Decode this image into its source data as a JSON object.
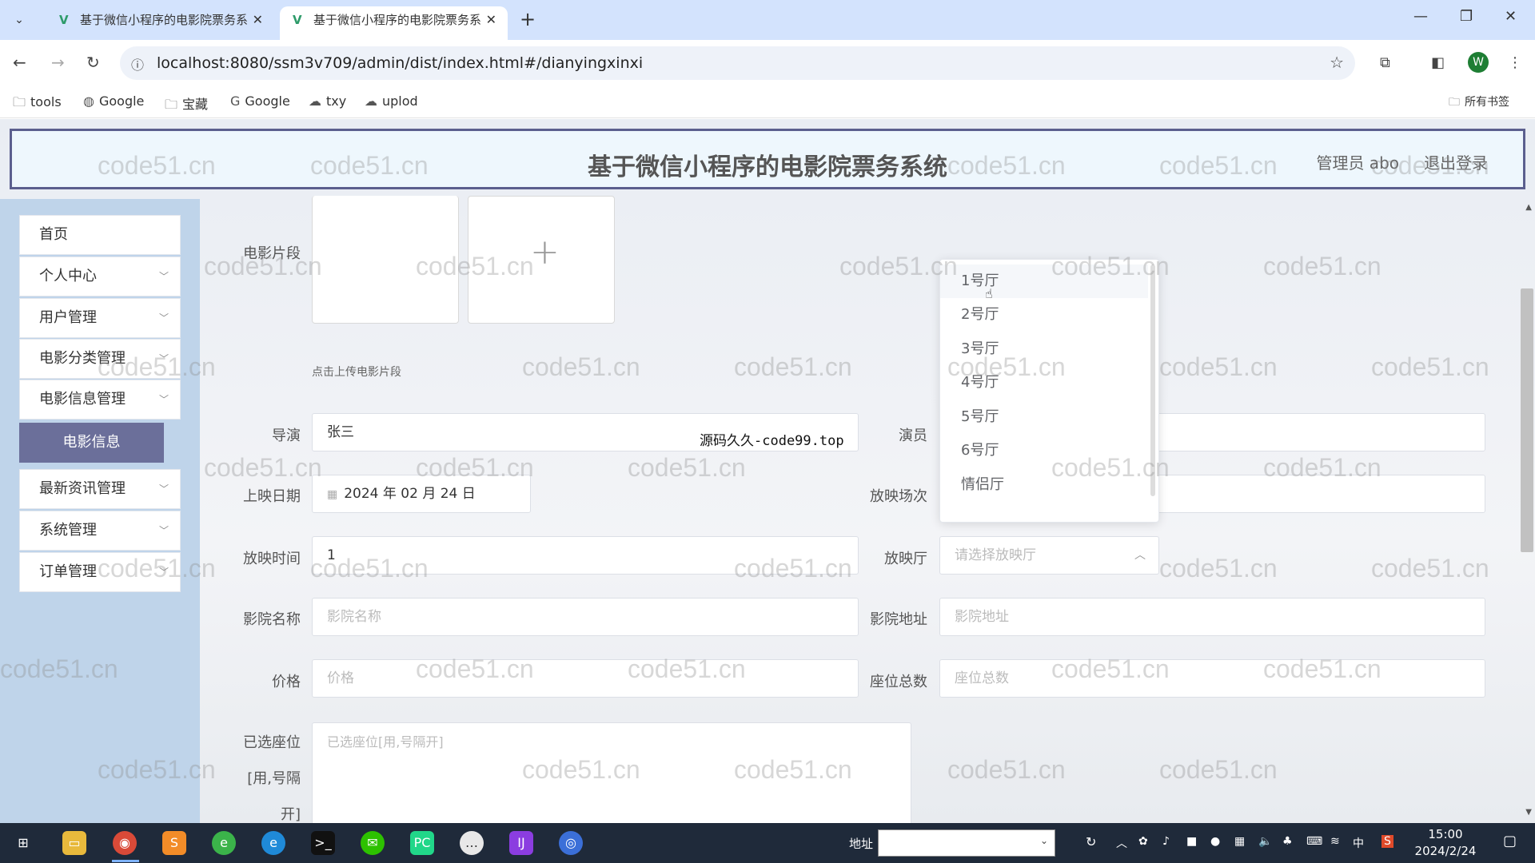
{
  "browser": {
    "tabs": [
      {
        "title": "基于微信小程序的电影院票务系统",
        "active": false
      },
      {
        "title": "基于微信小程序的电影院票务系统",
        "active": true
      }
    ],
    "url": "localhost:8080/ssm3v709/admin/dist/index.html#/dianyingxinxi",
    "profile_initial": "W",
    "bookmarks": [
      "tools",
      "Google",
      "宝藏",
      "Google",
      "txy",
      "uplod"
    ],
    "all_bookmarks": "所有书签"
  },
  "header": {
    "title": "基于微信小程序的电影院票务系统",
    "admin": "管理员 abo",
    "logout": "退出登录"
  },
  "sidebar": {
    "items": [
      {
        "label": "首页",
        "has_arrow": false
      },
      {
        "label": "个人中心",
        "has_arrow": true
      },
      {
        "label": "用户管理",
        "has_arrow": true
      },
      {
        "label": "电影分类管理",
        "has_arrow": true
      },
      {
        "label": "电影信息管理",
        "has_arrow": true
      },
      {
        "label": "最新资讯管理",
        "has_arrow": true
      },
      {
        "label": "系统管理",
        "has_arrow": true
      },
      {
        "label": "订单管理",
        "has_arrow": true
      }
    ],
    "active_sub": "电影信息"
  },
  "form": {
    "clip_label": "电影片段",
    "clip_tip": "点击上传电影片段",
    "director_label": "导演",
    "director_value": "张三",
    "actor_label": "演员",
    "release_label": "上映日期",
    "release_value": "2024 年 02 月 24 日",
    "session_label": "放映场次",
    "showtime_label": "放映时间",
    "showtime_value": "1",
    "hall_label": "放映厅",
    "hall_placeholder": "请选择放映厅",
    "cinema_name_label": "影院名称",
    "cinema_name_placeholder": "影院名称",
    "cinema_addr_label": "影院地址",
    "cinema_addr_placeholder": "影院地址",
    "price_label": "价格",
    "price_placeholder": "价格",
    "seats_label": "座位总数",
    "seats_placeholder": "座位总数",
    "selected_seats_label_1": "已选座位",
    "selected_seats_label_2": "[用,号隔",
    "selected_seats_label_3": "开]",
    "selected_seats_placeholder": "已选座位[用,号隔开]"
  },
  "dropdown": {
    "options": [
      "1号厅",
      "2号厅",
      "3号厅",
      "4号厅",
      "5号厅",
      "6号厅",
      "情侣厅"
    ]
  },
  "overlay": {
    "source_text": "源码久久-code99.top",
    "watermark": "code51.cn"
  },
  "taskbar": {
    "address_label": "地址",
    "time": "15:00",
    "date": "2024/2/24",
    "ime": "中"
  }
}
